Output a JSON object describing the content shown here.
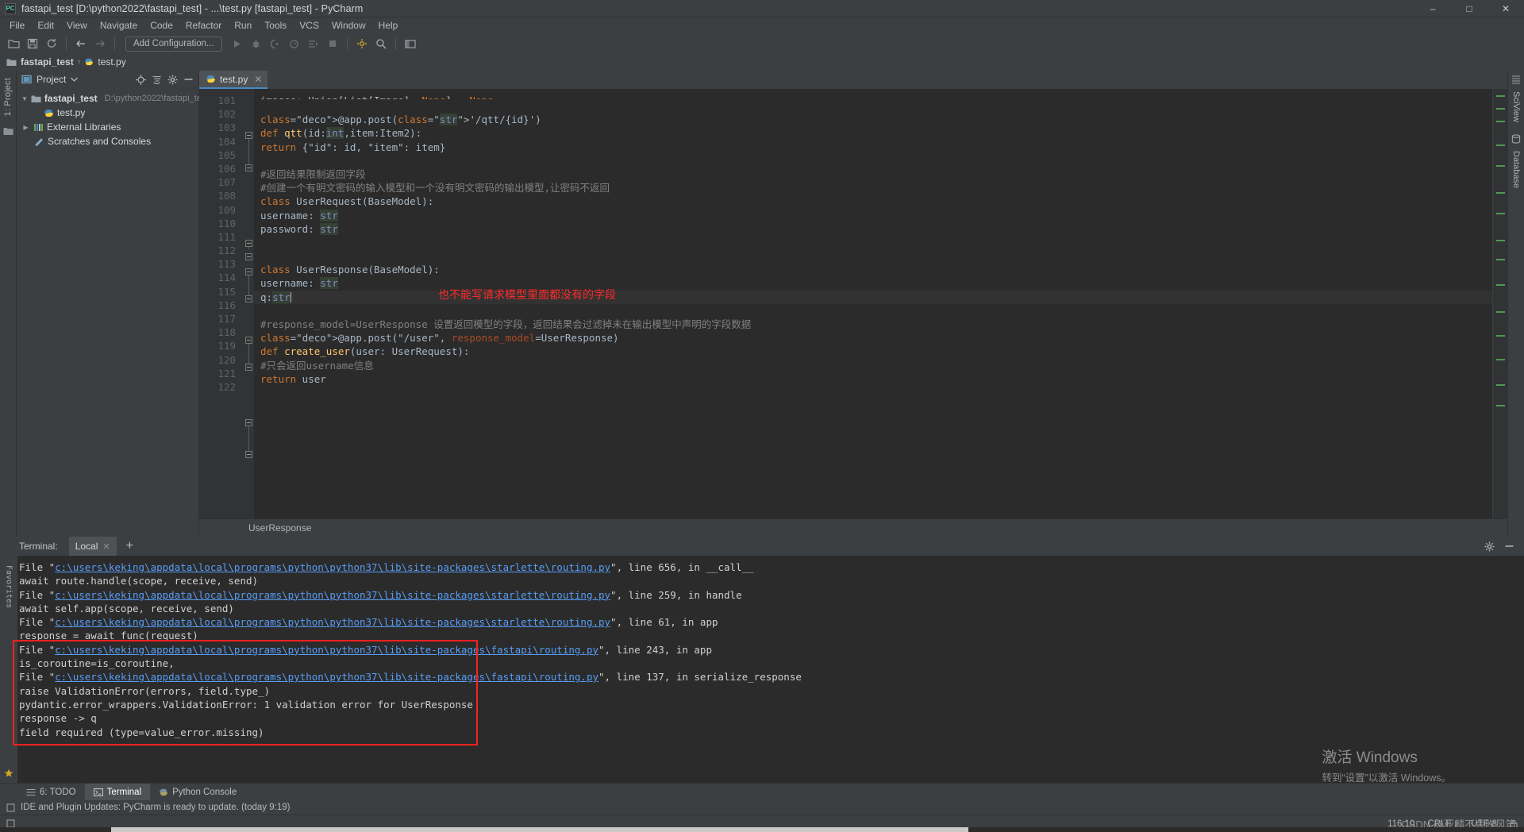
{
  "window": {
    "title": "fastapi_test [D:\\python2022\\fastapi_test] - ...\\test.py [fastapi_test] - PyCharm",
    "logo": "pycharm-logo",
    "controls": {
      "minimize": "–",
      "maximize": "□",
      "close": "✕"
    }
  },
  "menubar": {
    "items": [
      "File",
      "Edit",
      "View",
      "Navigate",
      "Code",
      "Refactor",
      "Run",
      "Tools",
      "VCS",
      "Window",
      "Help"
    ]
  },
  "toolbar": {
    "add_configuration": "Add Configuration...",
    "icons": [
      "open-folder-icon",
      "save-icon",
      "sync-icon",
      "back-arrow-icon",
      "forward-arrow-icon",
      "run-icon",
      "debug-icon",
      "run-coverage-icon",
      "profile-icon",
      "run-with-console-icon",
      "stop-icon",
      "build-icon",
      "search-icon",
      "layout-icon"
    ]
  },
  "breadcrumb": {
    "project": "fastapi_test",
    "separator": "›",
    "file": "test.py"
  },
  "project_panel": {
    "title": "Project",
    "rail_label": "1: Project",
    "actions": [
      "locate-icon",
      "collapse-all-icon",
      "settings-gear-icon",
      "hide-icon"
    ],
    "tree": [
      {
        "label": "fastapi_test",
        "path": "D:\\python2022\\fastapi_test",
        "icon": "folder-icon",
        "arrow": "▼",
        "bold": true,
        "indent": 0
      },
      {
        "label": "test.py",
        "path": "",
        "icon": "python-file-icon",
        "arrow": "",
        "bold": false,
        "indent": 1
      },
      {
        "label": "External Libraries",
        "path": "",
        "icon": "libraries-icon",
        "arrow": "▶",
        "bold": false,
        "indent": 0
      },
      {
        "label": "Scratches and Consoles",
        "path": "",
        "icon": "scratches-icon",
        "arrow": "",
        "bold": false,
        "indent": 0
      }
    ]
  },
  "editor": {
    "tab": {
      "label": "test.py",
      "icon": "python-file-icon",
      "close": "✕"
    },
    "first_visible_line": 101,
    "status_breadcrumb": "UserResponse",
    "annotation": "也不能写请求模型里面都没有的字段",
    "annotation_color": "#ff2a2a",
    "lines": [
      {
        "n": 101,
        "clipped": true,
        "html": "    images: Union[List[Image], None] = None"
      },
      {
        "n": 102,
        "html": ""
      },
      {
        "n": 103,
        "html": "@app.post('/qtt/{id}')"
      },
      {
        "n": 104,
        "html": "def qtt(id:int,item:Item2):"
      },
      {
        "n": 105,
        "html": "    return {\"id\": id, \"item\": item}"
      },
      {
        "n": 106,
        "html": ""
      },
      {
        "n": 107,
        "html": "#返回结果限制返回字段"
      },
      {
        "n": 108,
        "html": "#创建一个有明文密码的输入模型和一个没有明文密码的输出模型,让密码不返回"
      },
      {
        "n": 109,
        "html": "class UserRequest(BaseModel):"
      },
      {
        "n": 110,
        "html": "    username: str"
      },
      {
        "n": 111,
        "html": "    password: str"
      },
      {
        "n": 112,
        "html": ""
      },
      {
        "n": 113,
        "html": ""
      },
      {
        "n": 114,
        "html": "class UserResponse(BaseModel):"
      },
      {
        "n": 115,
        "html": "    username: str"
      },
      {
        "n": 116,
        "html": "    q:str",
        "current": true
      },
      {
        "n": 117,
        "html": ""
      },
      {
        "n": 118,
        "html": "#response_model=UserResponse  设置返回模型的字段，返回结果会过滤掉未在输出模型中声明的字段数据"
      },
      {
        "n": 119,
        "html": "@app.post(\"/user\", response_model=UserResponse)"
      },
      {
        "n": 120,
        "html": "def create_user(user: UserRequest):"
      },
      {
        "n": 121,
        "html": "    #只会返回username信息"
      },
      {
        "n": 122,
        "html": "    return user"
      }
    ]
  },
  "right_rail": {
    "items": [
      "SciView",
      "Database"
    ]
  },
  "terminal": {
    "label": "Terminal:",
    "tab": "Local",
    "tab_close": "✕",
    "add": "+",
    "actions": [
      "settings-gear-icon",
      "hide-icon"
    ],
    "rail_label": "Favorites",
    "lines": [
      {
        "pre": "  File \"",
        "link": "c:\\users\\keking\\appdata\\local\\programs\\python\\python37\\lib\\site-packages\\starlette\\routing.py",
        "post": "\", line 656, in __call__"
      },
      {
        "pre": "    await route.handle(scope, receive, send)",
        "link": "",
        "post": ""
      },
      {
        "pre": "  File \"",
        "link": "c:\\users\\keking\\appdata\\local\\programs\\python\\python37\\lib\\site-packages\\starlette\\routing.py",
        "post": "\", line 259, in handle"
      },
      {
        "pre": "    await self.app(scope, receive, send)",
        "link": "",
        "post": ""
      },
      {
        "pre": "  File \"",
        "link": "c:\\users\\keking\\appdata\\local\\programs\\python\\python37\\lib\\site-packages\\starlette\\routing.py",
        "post": "\", line 61, in app"
      },
      {
        "pre": "    response = await func(request)",
        "link": "",
        "post": ""
      },
      {
        "pre": "  File \"",
        "link": "c:\\users\\keking\\appdata\\local\\programs\\python\\python37\\lib\\site-packages\\fastapi\\routing.py",
        "post": "\", line 243, in app"
      },
      {
        "pre": "    is_coroutine=is_coroutine,",
        "link": "",
        "post": ""
      },
      {
        "pre": "  File \"",
        "link": "c:\\users\\keking\\appdata\\local\\programs\\python\\python37\\lib\\site-packages\\fastapi\\routing.py",
        "post": "\", line 137, in serialize_response"
      },
      {
        "pre": "    raise ValidationError(errors, field.type_)",
        "link": "",
        "post": ""
      },
      {
        "pre": "pydantic.error_wrappers.ValidationError: 1 validation error for UserResponse",
        "link": "",
        "post": ""
      },
      {
        "pre": "response -> q",
        "link": "",
        "post": ""
      },
      {
        "pre": "  field required (type=value_error.missing)",
        "link": "",
        "post": ""
      },
      {
        "pre": "",
        "link": "",
        "post": ""
      }
    ],
    "highlight_color": "#ff2020"
  },
  "tool_strip": {
    "items": [
      {
        "label": "6: TODO",
        "icon": "todo-icon",
        "active": false
      },
      {
        "label": "Terminal",
        "icon": "terminal-icon",
        "active": true
      },
      {
        "label": "Python Console",
        "icon": "python-console-icon",
        "active": false
      }
    ]
  },
  "notification": {
    "icon": "notification-icon",
    "text": "IDE and Plugin Updates: PyCharm is ready to update. (today 9:19)"
  },
  "statusbar": {
    "left_icon": "event-log-icon",
    "caret_position": "116:10",
    "line_separator": "CRLF",
    "line_separator_arrow": "↕",
    "encoding": "UTF-8",
    "lock_icon": "lock-icon",
    "event_log": "Event Log"
  },
  "watermarks": {
    "windows_line1": "激活 Windows",
    "windows_line2": "转到“设置”以激活 Windows。",
    "csdn": "CSDN @亚麟不会吹风笛"
  }
}
